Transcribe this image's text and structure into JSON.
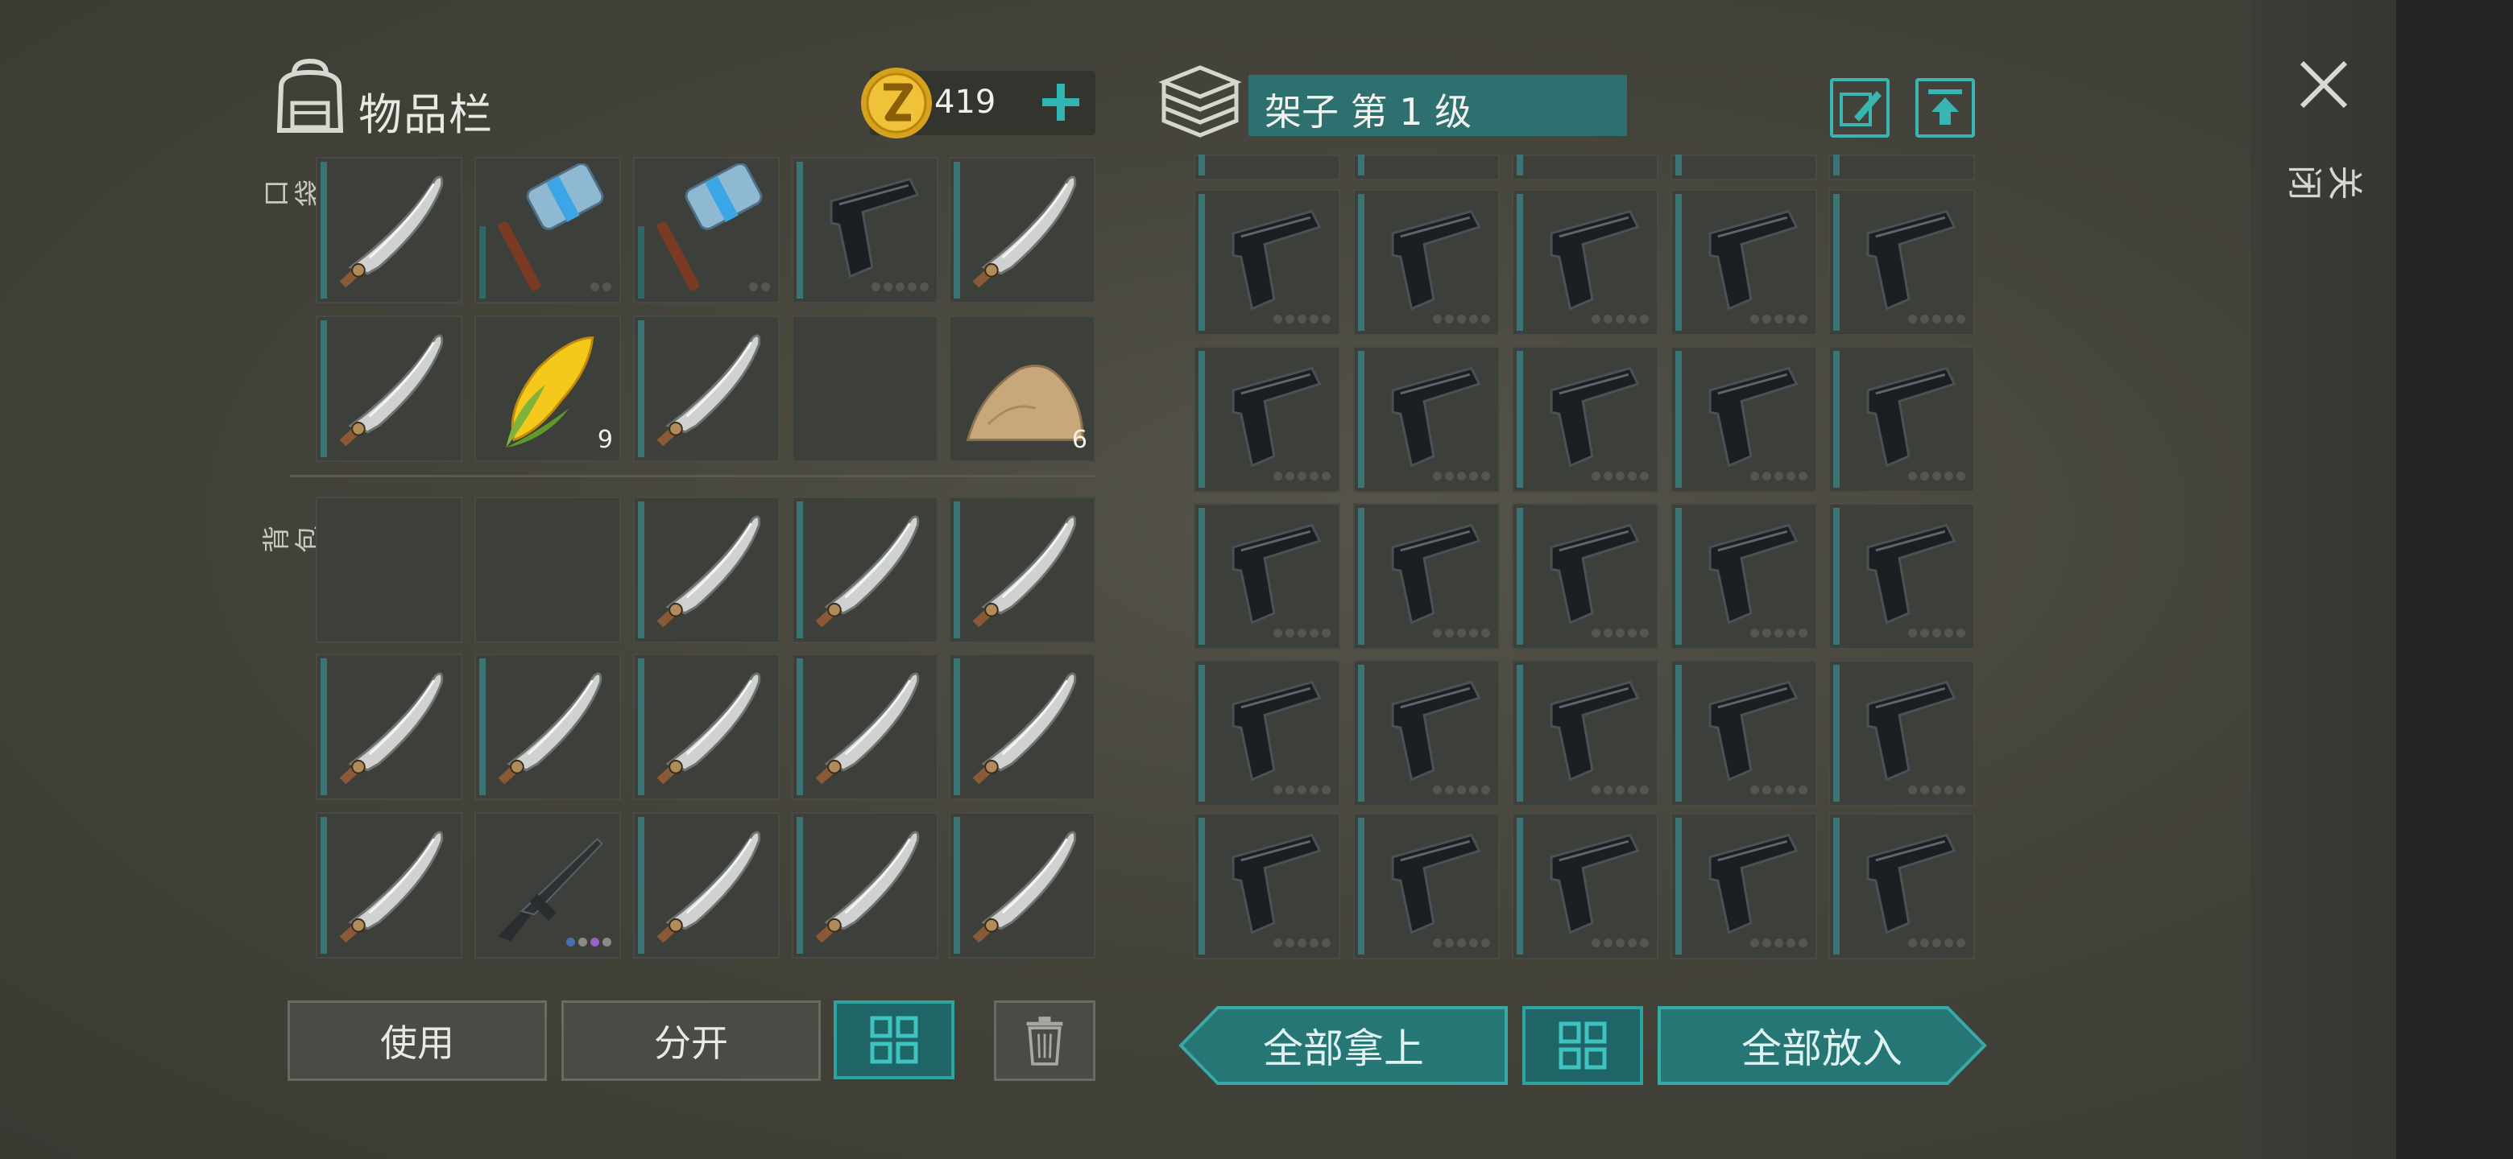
{
  "inventory": {
    "title": "物品栏",
    "coins": "419",
    "pocket_label": "口袋",
    "backpack_label": "背包",
    "pocket_slots": [
      {
        "item": "machete",
        "bar": "full"
      },
      {
        "item": "hammer",
        "bar": "short",
        "dots": 2
      },
      {
        "item": "hammer",
        "bar": "short",
        "dots": 2
      },
      {
        "item": "pistol",
        "bar": "full",
        "dots": 5
      },
      {
        "item": "machete",
        "bar": "full"
      },
      {
        "item": "machete",
        "bar": "full"
      },
      {
        "item": "corn",
        "bar": "none",
        "qty": "9"
      },
      {
        "item": "machete",
        "bar": "full"
      },
      {
        "item": "empty",
        "bar": "none"
      },
      {
        "item": "sand",
        "bar": "none",
        "qty": "6"
      }
    ],
    "backpack_slots": [
      {
        "item": "empty",
        "bar": "none"
      },
      {
        "item": "empty",
        "bar": "none"
      },
      {
        "item": "machete",
        "bar": "full"
      },
      {
        "item": "machete",
        "bar": "full"
      },
      {
        "item": "machete",
        "bar": "full"
      },
      {
        "item": "machete",
        "bar": "full"
      },
      {
        "item": "machete",
        "bar": "full"
      },
      {
        "item": "machete",
        "bar": "full"
      },
      {
        "item": "machete",
        "bar": "full"
      },
      {
        "item": "machete",
        "bar": "full"
      },
      {
        "item": "machete",
        "bar": "full"
      },
      {
        "item": "rifle",
        "bar": "none",
        "dots": 4
      },
      {
        "item": "machete",
        "bar": "full"
      },
      {
        "item": "machete",
        "bar": "full"
      },
      {
        "item": "machete",
        "bar": "full"
      }
    ],
    "buttons": {
      "use": "使用",
      "split": "分开"
    }
  },
  "storage": {
    "name": "架子 第 1 级",
    "item": "pistol",
    "rows": 5,
    "cols": 5,
    "buttons": {
      "take_all": "全部拿上",
      "put_all": "全部放入"
    }
  },
  "close": {
    "label": "关闭"
  },
  "colors": {
    "accent": "#2ea4a2",
    "durability_bar": "#3a7474",
    "slot_bg": "#3d3f3a"
  },
  "icons": [
    "backpack-icon",
    "coin-icon",
    "plus-icon",
    "chest-icon",
    "edit-icon",
    "upload-icon",
    "close-icon",
    "sort-grid-icon",
    "trash-icon"
  ]
}
